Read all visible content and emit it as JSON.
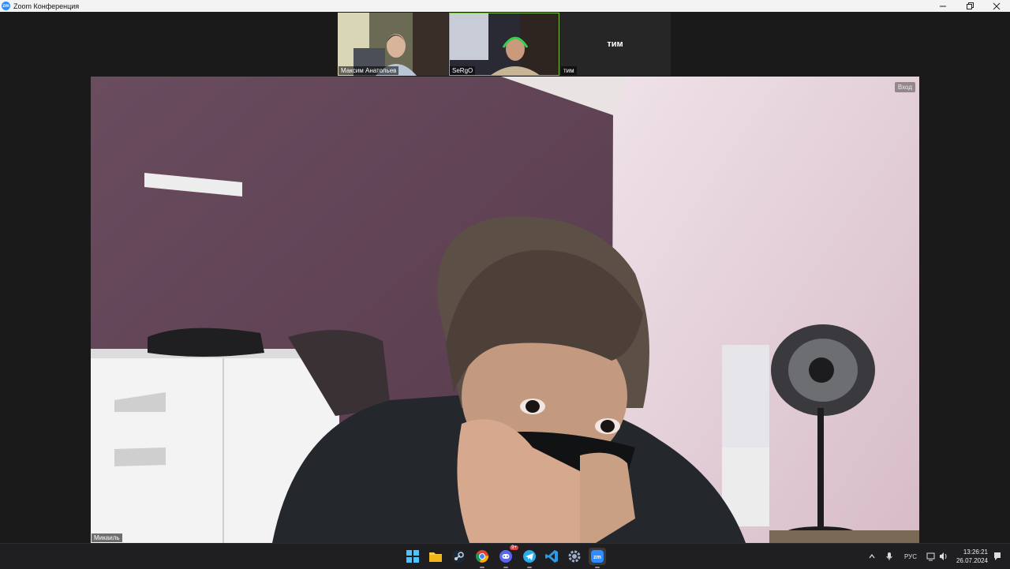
{
  "window": {
    "title": "Zoom Конференция"
  },
  "thumbnails": [
    {
      "name": "Максим Анатольев",
      "active": false
    },
    {
      "name": "SeRgO",
      "active": true
    },
    {
      "name": "тим",
      "label": "тим"
    }
  ],
  "main_video": {
    "name": "Микаиль",
    "badge": "Вход"
  },
  "taskbar": {
    "tray": {
      "language": "РУС"
    },
    "clock": {
      "time": "13:26:21",
      "date": "26.07.2024"
    },
    "apps": [
      "windows-start",
      "file-explorer",
      "steam",
      "chrome",
      "discord",
      "telegram",
      "vscode",
      "settings",
      "zoom"
    ],
    "badges": {
      "discord": "9+"
    }
  },
  "colors": {
    "active_speaker_border": "#7bc043",
    "taskbar_bg": "#1f1f22",
    "zoom_blue": "#2d8cff"
  }
}
